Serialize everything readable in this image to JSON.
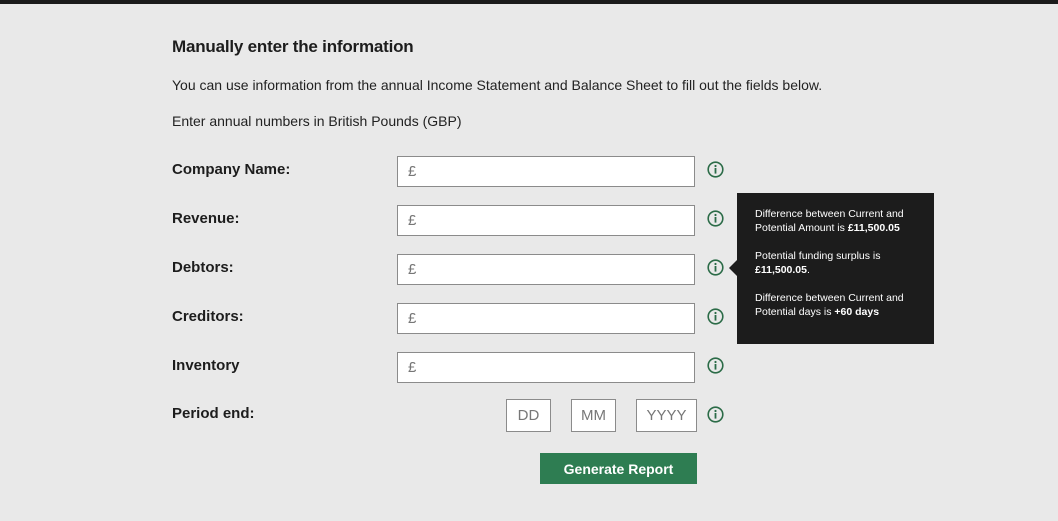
{
  "heading": "Manually enter the information",
  "intro": {
    "line1": "You can use information from the annual Income Statement and Balance Sheet to fill out the fields below.",
    "line2": "Enter annual numbers in British Pounds (GBP)"
  },
  "fields": [
    {
      "label": "Company Name:",
      "placeholder": "£",
      "value": ""
    },
    {
      "label": "Revenue:",
      "placeholder": "£",
      "value": ""
    },
    {
      "label": "Debtors:",
      "placeholder": "£",
      "value": ""
    },
    {
      "label": "Creditors:",
      "placeholder": "£",
      "value": ""
    },
    {
      "label": "Inventory",
      "placeholder": "£",
      "value": ""
    }
  ],
  "period_end": {
    "label": "Period end:",
    "day_placeholder": "DD",
    "month_placeholder": "MM",
    "year_placeholder": "YYYY"
  },
  "info_icon": "info-circle-icon",
  "tooltip": {
    "p1_text": "Difference between Current and Potential Amount is ",
    "p1_value": "£11,500.05",
    "p2_text": "Potential funding surplus is ",
    "p2_value": "£11,500.05",
    "p2_suffix": ".",
    "p3_text": "Difference between Current and Potential days is ",
    "p3_value": "+60 days"
  },
  "generate_button": "Generate Report",
  "colors": {
    "background": "#e9e9e9",
    "accent": "#2e7d52",
    "tooltip_bg": "#1c1c1c",
    "icon": "#2b6b47"
  }
}
